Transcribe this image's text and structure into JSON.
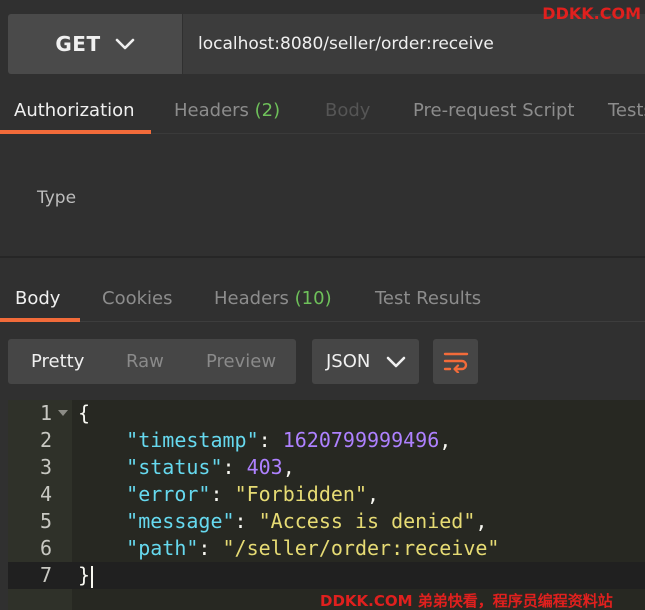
{
  "request": {
    "method": "GET",
    "url": "localhost:8080/seller/order:receive"
  },
  "request_tabs": {
    "authorization": "Authorization",
    "headers": "Headers",
    "headers_count": "(2)",
    "body": "Body",
    "prerequest": "Pre-request Script",
    "tests": "Tests"
  },
  "auth": {
    "type_label": "Type"
  },
  "response_tabs": {
    "body": "Body",
    "cookies": "Cookies",
    "headers": "Headers",
    "headers_count": "(10)",
    "test_results": "Test Results"
  },
  "view_modes": {
    "pretty": "Pretty",
    "raw": "Raw",
    "preview": "Preview"
  },
  "format": {
    "selected": "JSON"
  },
  "response_body": {
    "line_numbers": [
      "1",
      "2",
      "3",
      "4",
      "5",
      "6",
      "7"
    ],
    "open_brace": "{",
    "close_brace": "}",
    "fields": [
      {
        "key": "\"timestamp\"",
        "value": "1620799999496",
        "type": "number",
        "trail": ","
      },
      {
        "key": "\"status\"",
        "value": "403",
        "type": "number",
        "trail": ","
      },
      {
        "key": "\"error\"",
        "value": "\"Forbidden\"",
        "type": "string",
        "trail": ","
      },
      {
        "key": "\"message\"",
        "value": "\"Access is denied\"",
        "type": "string",
        "trail": ","
      },
      {
        "key": "\"path\"",
        "value": "\"/seller/order:receive\"",
        "type": "string",
        "trail": ""
      }
    ]
  },
  "watermarks": {
    "top": "DDKK.COM",
    "bottom": "DDKK.COM 弟弟快看，程序员编程资料站"
  },
  "colors": {
    "accent": "#f26b3a",
    "count_green": "#6ec05a",
    "json_key": "#66d9ef",
    "json_number": "#ae81ff",
    "json_string": "#e6db74",
    "watermark": "#e0201e"
  },
  "icons": {
    "method_dropdown": "chevron-down-icon",
    "format_dropdown": "chevron-down-icon",
    "wrap": "wrap-lines-icon",
    "fold": "fold-arrow-icon"
  }
}
